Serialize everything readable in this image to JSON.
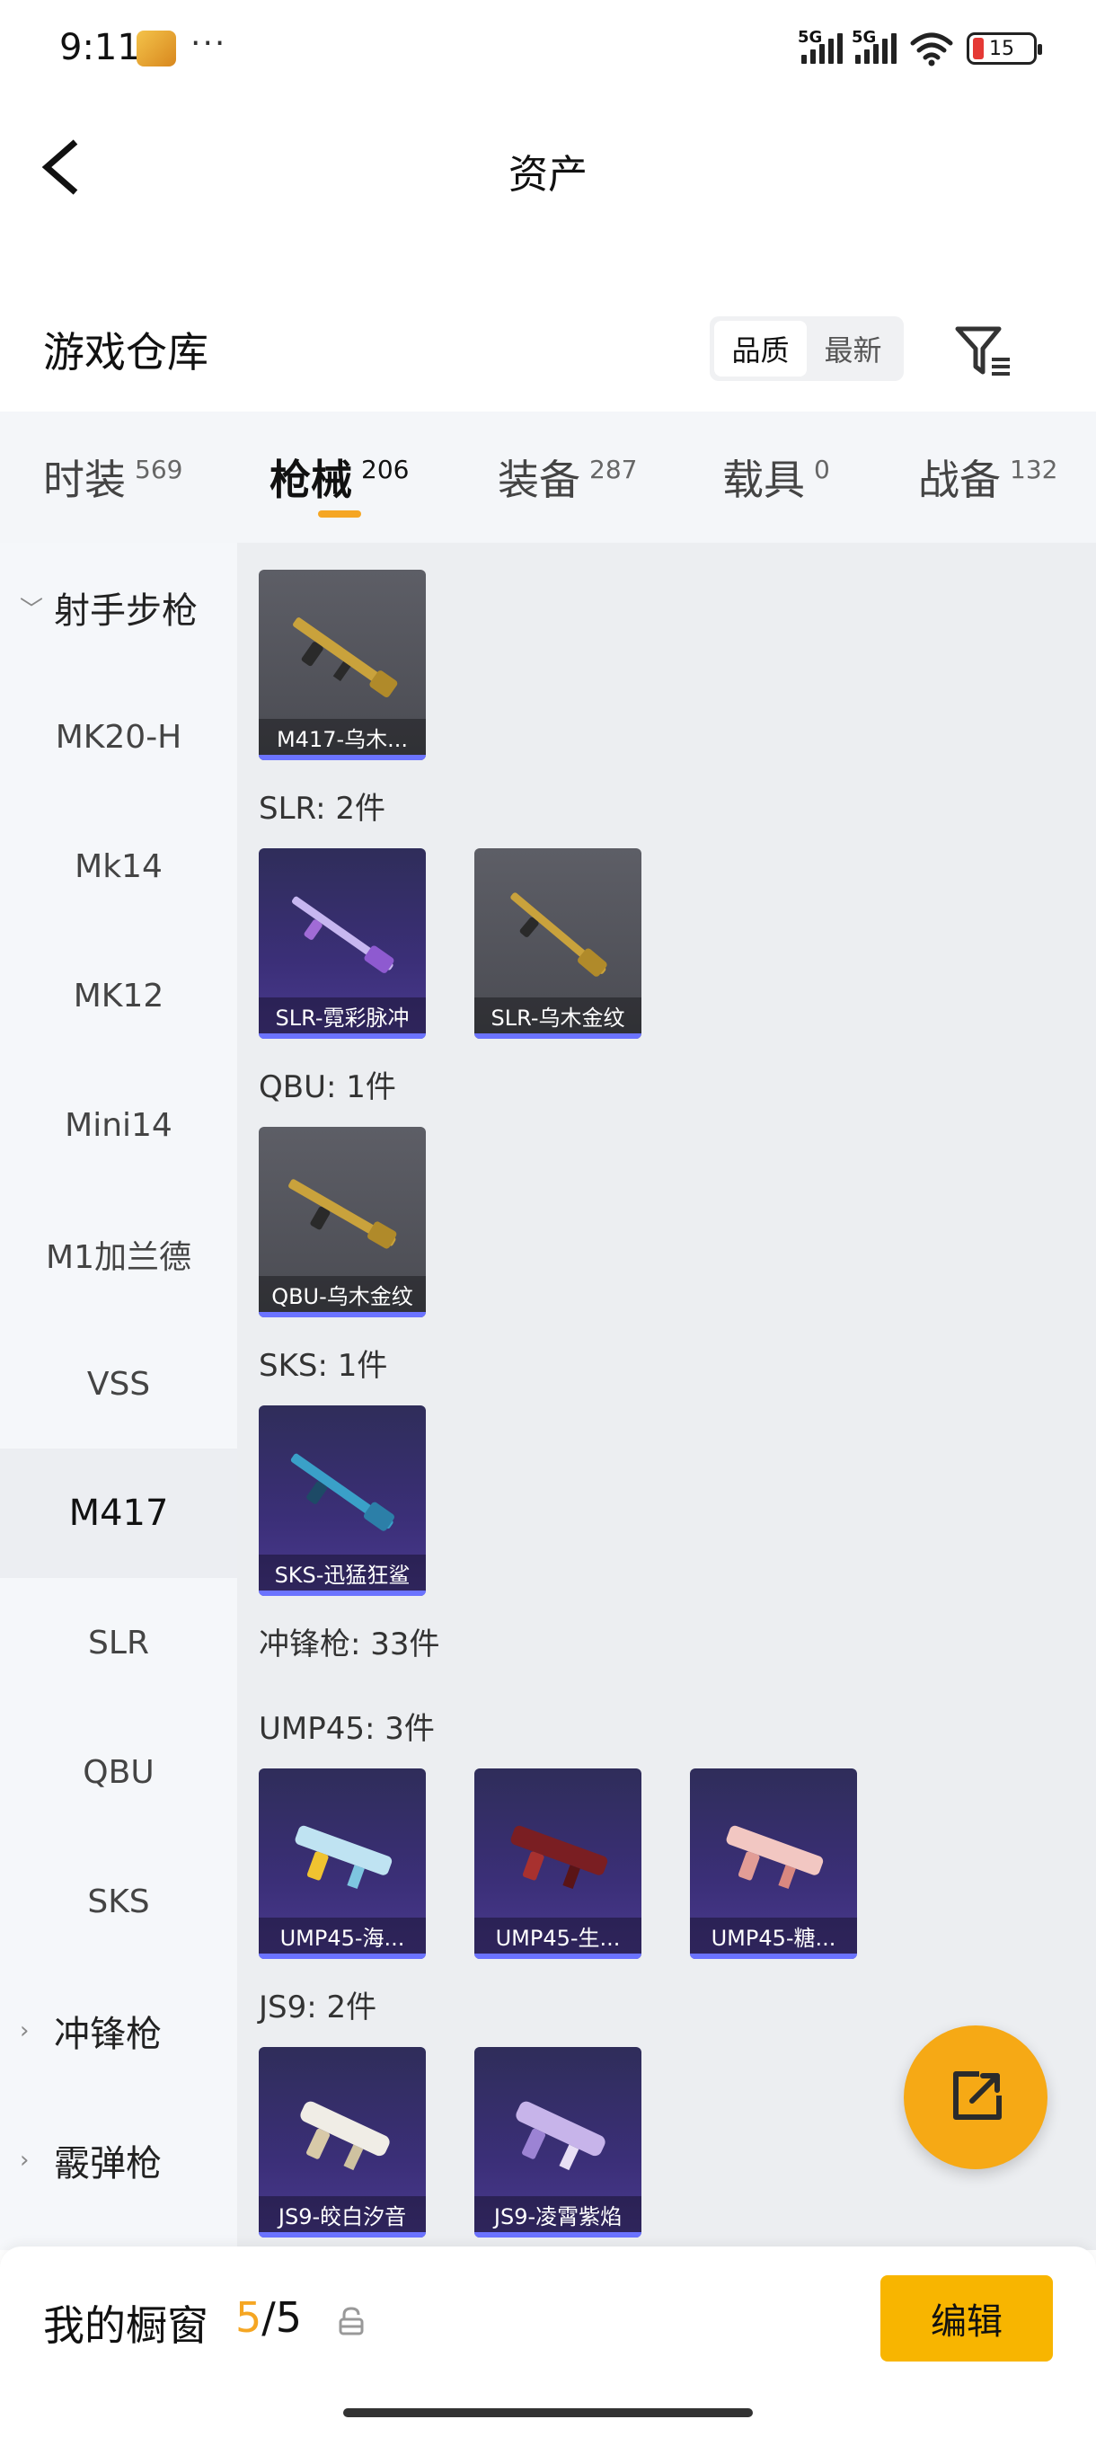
{
  "status": {
    "time": "9:11",
    "dots": "···",
    "signal1": "5G",
    "signal2": "5G",
    "battery": "15"
  },
  "header": {
    "title": "资产"
  },
  "warehouse": {
    "title": "游戏仓库",
    "sort": [
      "品质",
      "最新"
    ],
    "sort_active": 0
  },
  "categories": [
    {
      "label": "时装",
      "count": "569"
    },
    {
      "label": "枪械",
      "count": "206"
    },
    {
      "label": "装备",
      "count": "287"
    },
    {
      "label": "载具",
      "count": "0"
    },
    {
      "label": "战备",
      "count": "132"
    }
  ],
  "active_category": 1,
  "sidebar": {
    "group1": "射手步枪",
    "items": [
      "MK20-H",
      "Mk14",
      "MK12",
      "Mini14",
      "M1加兰德",
      "VSS",
      "M417",
      "SLR",
      "QBU",
      "SKS"
    ],
    "selected": "M417",
    "group2": "冲锋枪",
    "group3": "霰弹枪"
  },
  "content": {
    "m417": [
      {
        "name": "M417-乌木...",
        "style": "gray"
      }
    ],
    "slr_label": "SLR: 2件",
    "slr": [
      {
        "name": "SLR-霓彩脉冲",
        "style": "purple"
      },
      {
        "name": "SLR-乌木金纹",
        "style": "gray"
      }
    ],
    "qbu_label": "QBU: 1件",
    "qbu": [
      {
        "name": "QBU-乌木金纹",
        "style": "gray"
      }
    ],
    "sks_label": "SKS: 1件",
    "sks": [
      {
        "name": "SKS-迅猛狂鲨",
        "style": "purple"
      }
    ],
    "smg_label": "冲锋枪: 33件",
    "ump_label": "UMP45: 3件",
    "ump": [
      {
        "name": "UMP45-海...",
        "style": "purple"
      },
      {
        "name": "UMP45-生...",
        "style": "purple"
      },
      {
        "name": "UMP45-糖...",
        "style": "purple"
      }
    ],
    "js9_label": "JS9: 2件",
    "js9": [
      {
        "name": "JS9-皎白汐音",
        "style": "purple"
      },
      {
        "name": "JS9-凌霄紫焰",
        "style": "purple"
      }
    ]
  },
  "bottom": {
    "label": "我的橱窗",
    "count_used": "5",
    "count_sep": "/",
    "count_total": "5",
    "edit": "编辑"
  },
  "colors": {
    "accent": "#f5a623",
    "button": "#f8b500",
    "card_bar": "#6b73ff"
  }
}
